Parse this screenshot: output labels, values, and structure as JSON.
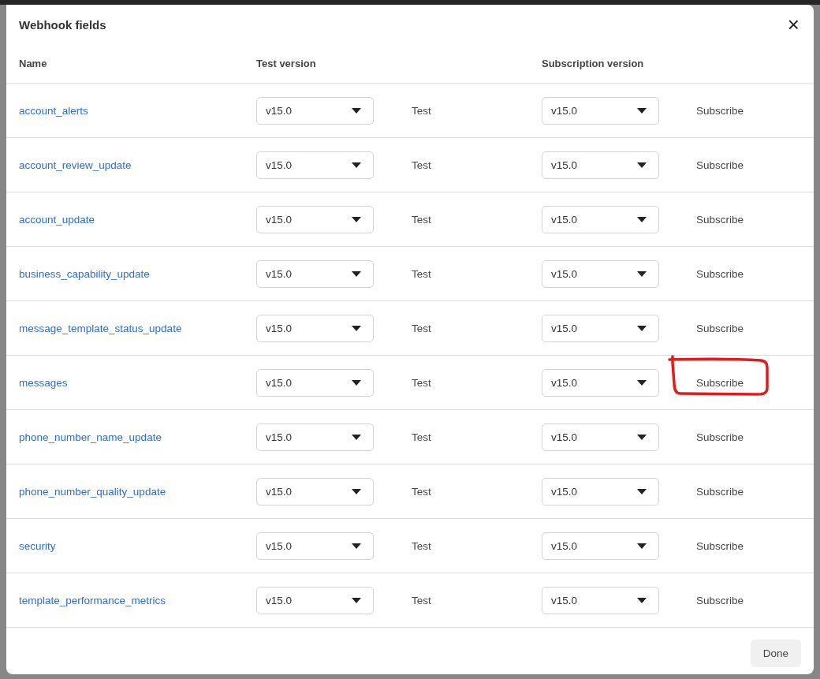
{
  "dialog": {
    "title": "Webhook fields",
    "close_label": "×"
  },
  "columns": [
    "Name",
    "Test version",
    "",
    "Subscription version",
    ""
  ],
  "rows": [
    {
      "name": "account_alerts",
      "test_version": "v15.0",
      "test_action": "Test",
      "subscription_version": "v15.0",
      "subscribe_action": "Subscribe",
      "annotated": false
    },
    {
      "name": "account_review_update",
      "test_version": "v15.0",
      "test_action": "Test",
      "subscription_version": "v15.0",
      "subscribe_action": "Subscribe",
      "annotated": false
    },
    {
      "name": "account_update",
      "test_version": "v15.0",
      "test_action": "Test",
      "subscription_version": "v15.0",
      "subscribe_action": "Subscribe",
      "annotated": false
    },
    {
      "name": "business_capability_update",
      "test_version": "v15.0",
      "test_action": "Test",
      "subscription_version": "v15.0",
      "subscribe_action": "Subscribe",
      "annotated": false
    },
    {
      "name": "message_template_status_update",
      "test_version": "v15.0",
      "test_action": "Test",
      "subscription_version": "v15.0",
      "subscribe_action": "Subscribe",
      "annotated": false
    },
    {
      "name": "messages",
      "test_version": "v15.0",
      "test_action": "Test",
      "subscription_version": "v15.0",
      "subscribe_action": "Subscribe",
      "annotated": true
    },
    {
      "name": "phone_number_name_update",
      "test_version": "v15.0",
      "test_action": "Test",
      "subscription_version": "v15.0",
      "subscribe_action": "Subscribe",
      "annotated": false
    },
    {
      "name": "phone_number_quality_update",
      "test_version": "v15.0",
      "test_action": "Test",
      "subscription_version": "v15.0",
      "subscribe_action": "Subscribe",
      "annotated": false
    },
    {
      "name": "security",
      "test_version": "v15.0",
      "test_action": "Test",
      "subscription_version": "v15.0",
      "subscribe_action": "Subscribe",
      "annotated": false
    },
    {
      "name": "template_performance_metrics",
      "test_version": "v15.0",
      "test_action": "Test",
      "subscription_version": "v15.0",
      "subscribe_action": "Subscribe",
      "annotated": false
    }
  ],
  "footer": {
    "done_button": "Done"
  }
}
